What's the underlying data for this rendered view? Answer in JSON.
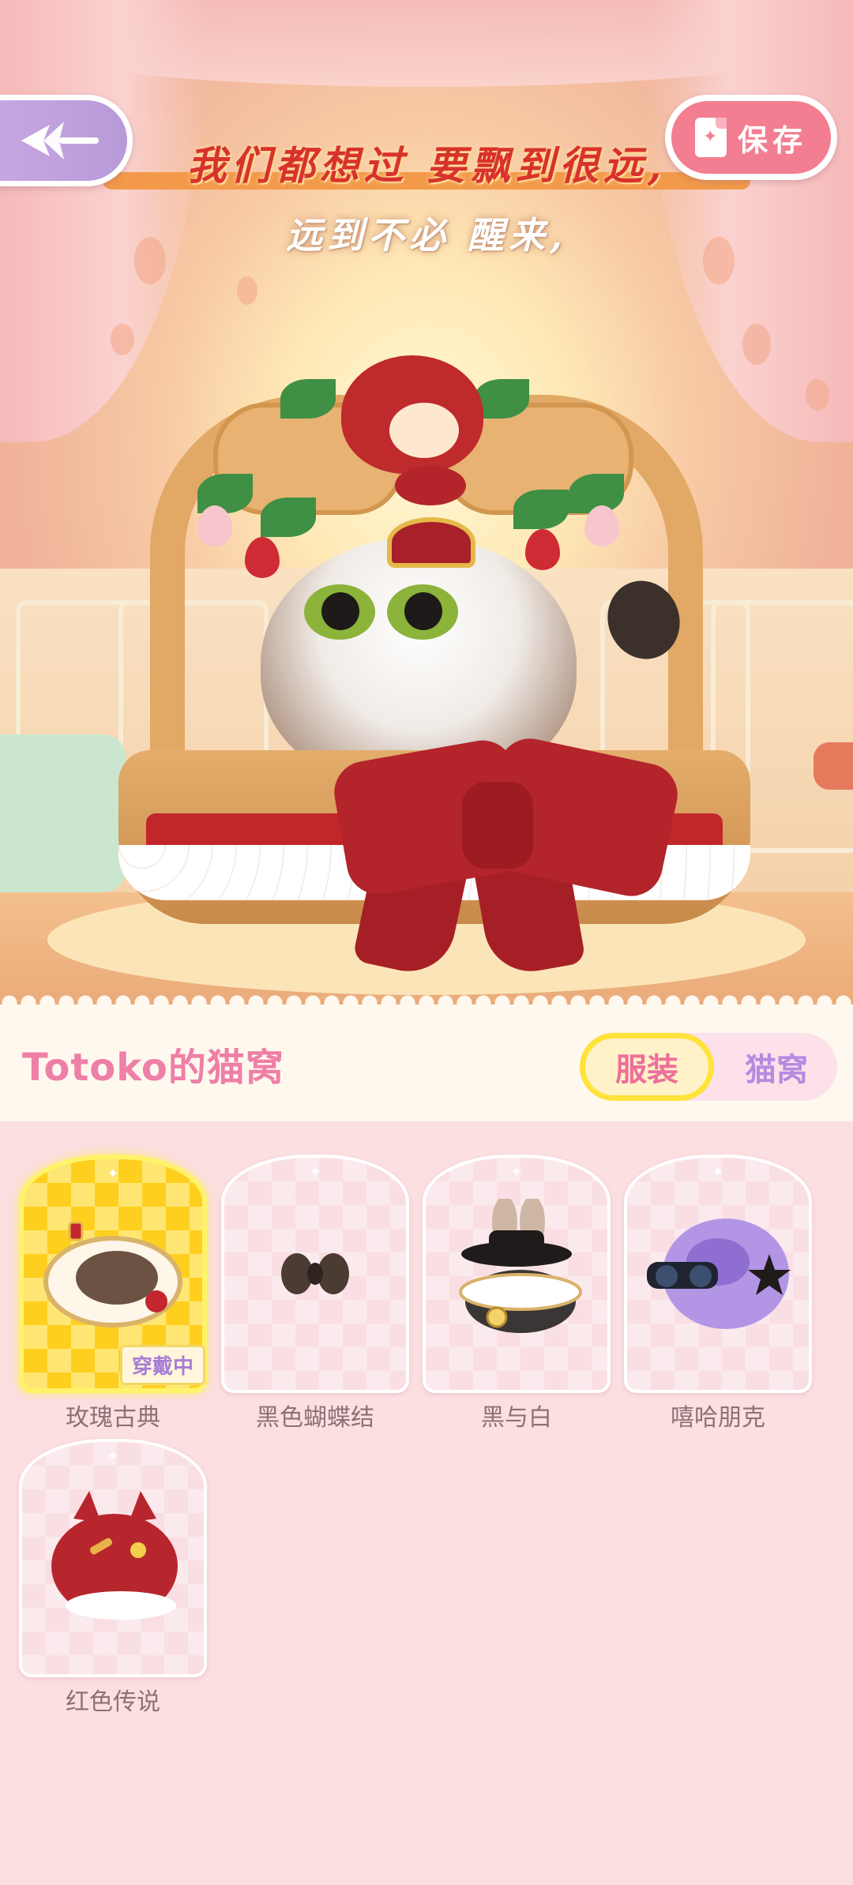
{
  "lyrics": {
    "line1": "我们都想过 要飘到很远,",
    "line2": "远到不必 醒来,"
  },
  "save_button": {
    "label": "保存"
  },
  "header": {
    "title": "Totoko的猫窝",
    "toggle": {
      "active": "服装",
      "inactive": "猫窝"
    }
  },
  "items": [
    {
      "name": "玫瑰古典",
      "equipped_badge": "穿戴中"
    },
    {
      "name": "黑色蝴蝶结"
    },
    {
      "name": "黑与白"
    },
    {
      "name": "嘻哈朋克"
    },
    {
      "name": "红色传说"
    }
  ],
  "colors": {
    "accent_pink": "#f37d91",
    "title_pink": "#ee7fa6",
    "toggle_highlight": "#ffe23a",
    "selected_card": "#ffcf1f"
  }
}
